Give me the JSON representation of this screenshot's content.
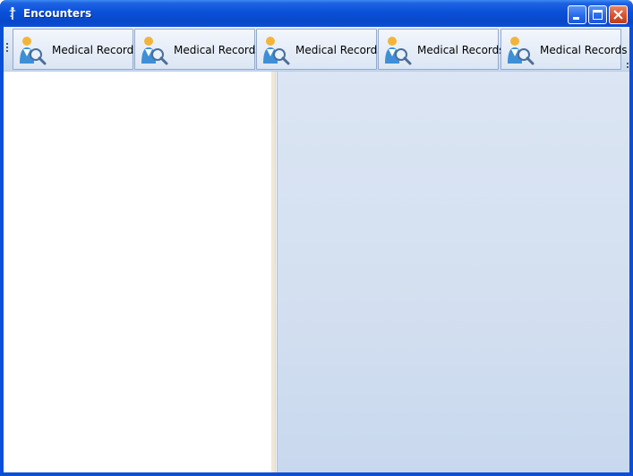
{
  "window": {
    "title": "Encounters",
    "controls": {
      "minimize": "minimize-icon",
      "maximize": "maximize-icon",
      "close": "close-icon"
    }
  },
  "toolbar": {
    "buttons": [
      {
        "label": "Medical Records",
        "icon": "medical-records-icon"
      },
      {
        "label": "Medical Records",
        "icon": "medical-records-icon"
      },
      {
        "label": "Medical Records",
        "icon": "medical-records-icon"
      },
      {
        "label": "Medical Records",
        "icon": "medical-records-icon"
      },
      {
        "label": "Medical Records",
        "icon": "medical-records-icon"
      }
    ]
  },
  "colors": {
    "titlebar": "#0a51d9",
    "toolbar": "#dbe6f4",
    "right_pane": "#d3dff0",
    "splitter": "#efe8d6"
  }
}
